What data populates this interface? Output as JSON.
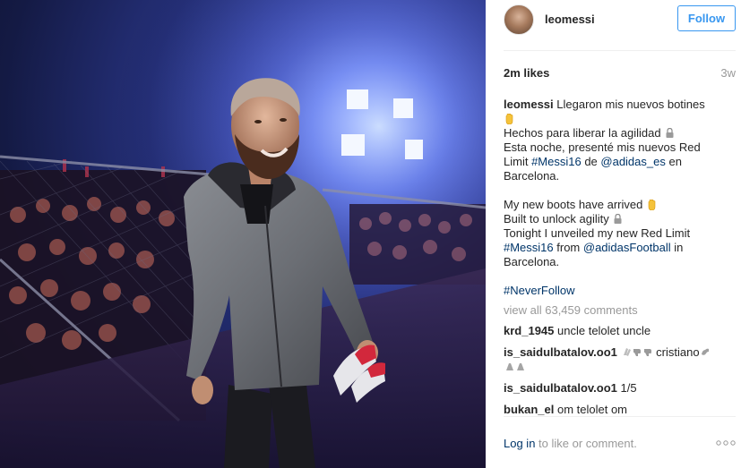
{
  "post": {
    "photo_alt": "",
    "header": {
      "username": "leomessi",
      "follow_label": "Follow"
    },
    "likes": "2m likes",
    "age": "3w",
    "caption": {
      "username": "leomessi",
      "lines_es": [
        "Llegaron mis nuevos botines",
        "Hechos para liberar la agilidad",
        "Esta noche, presenté mis nuevos Red",
        "Limit",
        "#Messi16",
        "de",
        "@adidas_es",
        "en",
        "Barcelona."
      ],
      "line1": "Llegaron mis nuevos botines",
      "line2": "Hechos para liberar la agilidad",
      "line3": "Esta noche, presenté mis nuevos Red",
      "line4_pre": "Limit ",
      "line4_tag": "#Messi16",
      "line4_mid": " de ",
      "line4_mention": "@adidas_es",
      "line4_post": " en",
      "line5": "Barcelona.",
      "line6": "My new boots have arrived",
      "line7": "Built to unlock agility",
      "line8": "Tonight I unveiled my new Red Limit",
      "line9_tag": "#Messi16",
      "line9_mid": " from ",
      "line9_mention": "@adidasFootball",
      "line9_post": " in",
      "line10": "Barcelona.",
      "hashtag": "#NeverFollow"
    },
    "view_all_comments": "view all 63,459 comments",
    "comments": [
      {
        "user": "krd_1945",
        "text": "uncle telolet uncle"
      },
      {
        "user": "is_saidulbatalov.oo1",
        "text": "cristiano"
      },
      {
        "user": "is_saidulbatalov.oo1",
        "text": "1/5"
      },
      {
        "user": "bukan_el",
        "text": "om telolet om"
      }
    ],
    "footer": {
      "login_link": "Log in",
      "login_text": " to like or comment."
    }
  },
  "icons": {
    "more": "more-options-icon",
    "hand": "raised-hand-emoji",
    "lock": "lock-emoji"
  },
  "colors": {
    "link": "#003569",
    "follow": "#3897f0",
    "muted": "#999999"
  }
}
